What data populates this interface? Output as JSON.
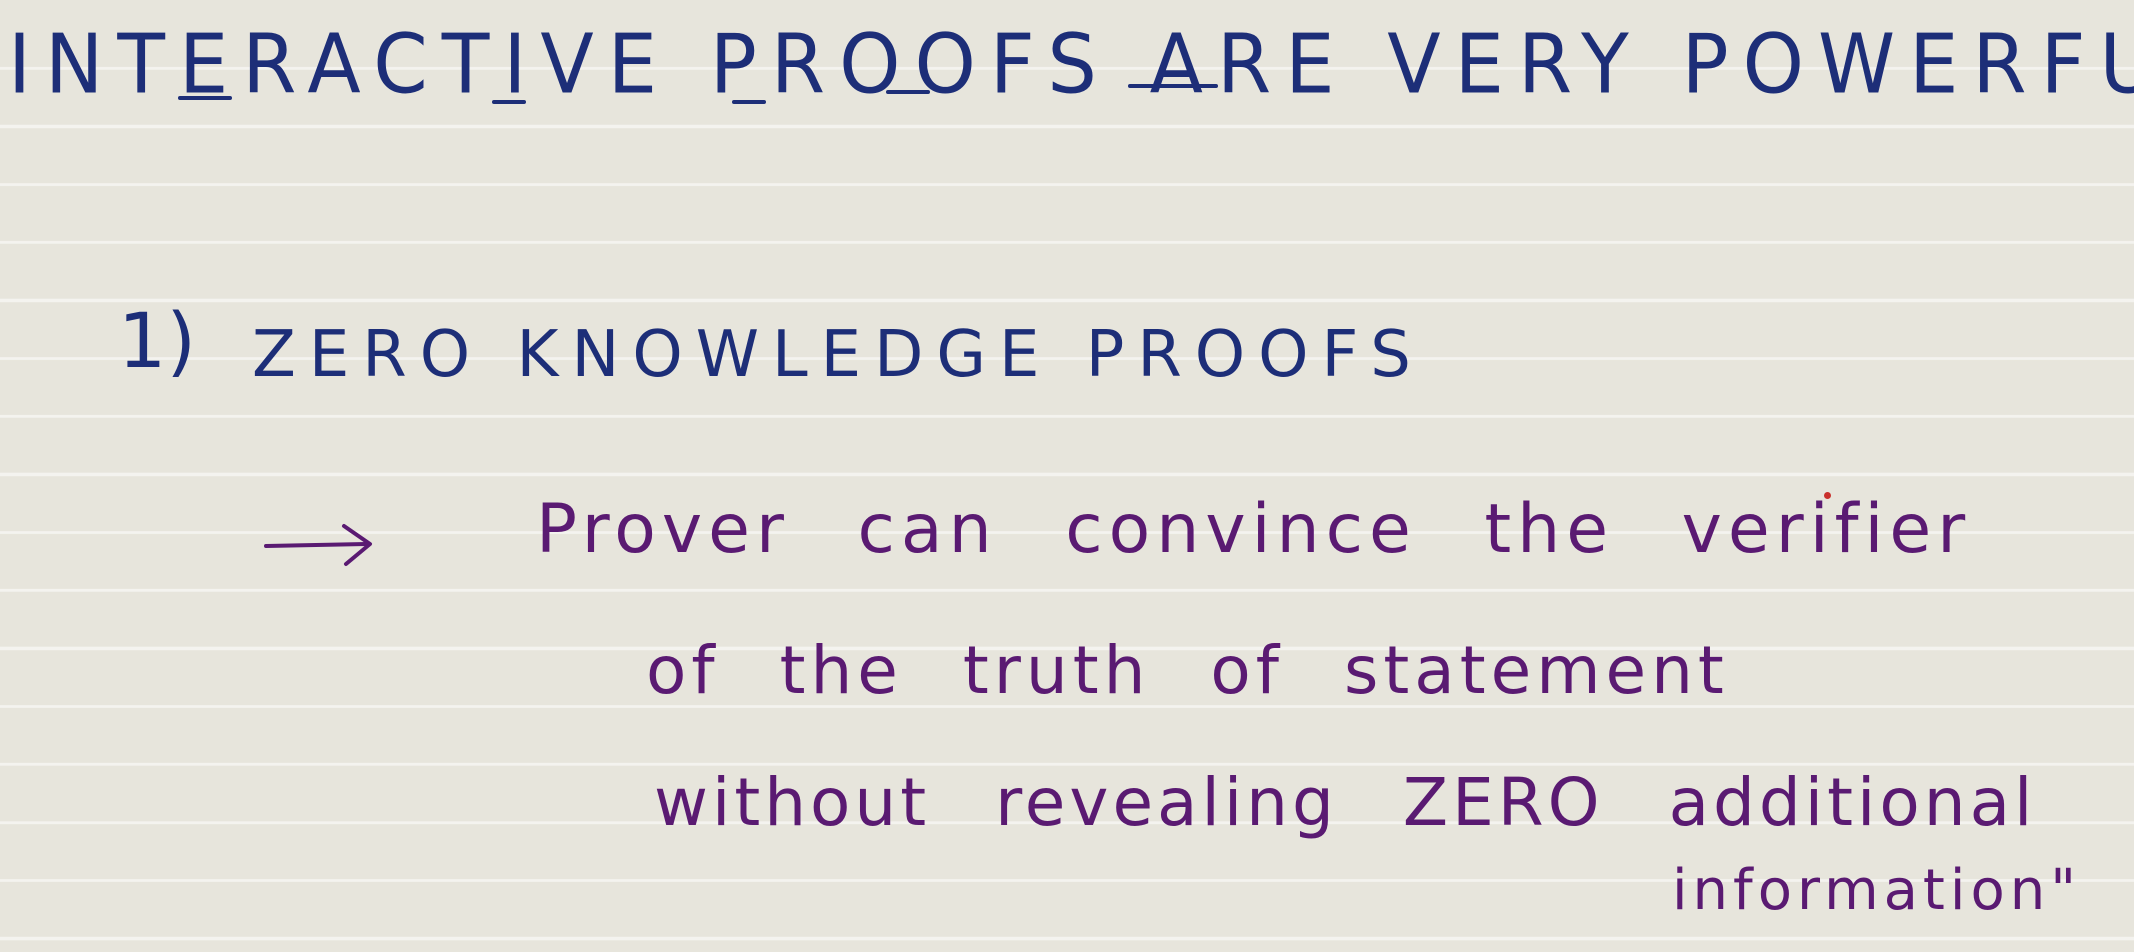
{
  "heading": {
    "title": "INTERACTIVE PROOFS ARE VERY POWERFUL"
  },
  "item": {
    "number": "1)",
    "title": "ZERO KNOWLEDGE PROOFS"
  },
  "note": {
    "arrow_icon": "right-arrow-icon",
    "line1": "Prover can convince the verifier",
    "line2": "of the truth of statement",
    "line3": "without revealing ZERO additional",
    "line4": "information\""
  },
  "colors": {
    "paper": "#e7e5dc",
    "rule_lines": "#ffffff",
    "blue_ink": "#1d2e78",
    "purple_ink": "#5a1a72",
    "red_dot": "#c9302c"
  }
}
